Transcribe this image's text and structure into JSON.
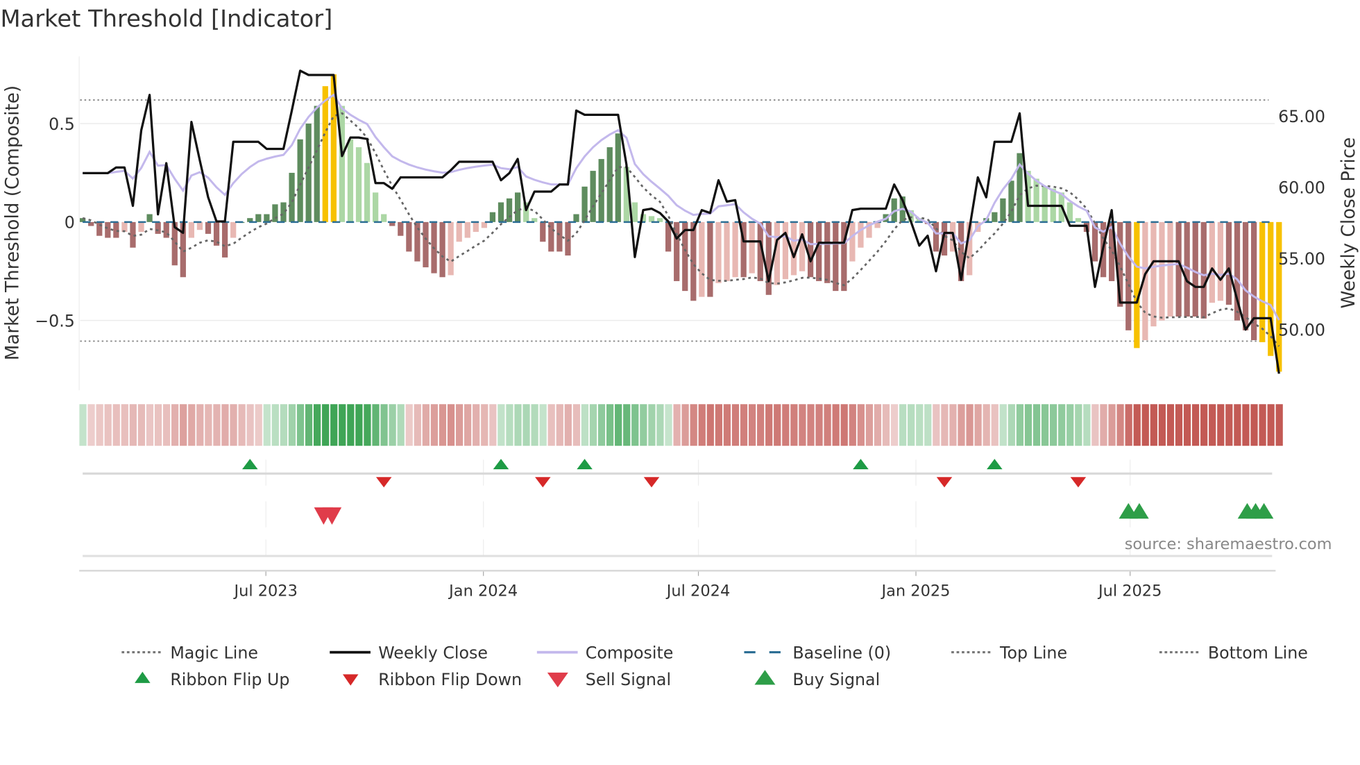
{
  "title": "Market Threshold [Indicator]",
  "source": "source: sharemaestro.com",
  "colors": {
    "dark_green": "#5e8c5e",
    "light_green": "#acd7a5",
    "dark_red": "#a86c6c",
    "light_red": "#e8b8b3",
    "yellow": "#f7c100",
    "close": "#111111",
    "composite": "#c3b8ec",
    "magic": "#666666",
    "baseline": "#2c6e94",
    "flip_up": "#1e9b45",
    "flip_down": "#d62828",
    "sell": "#e03c4a",
    "buy": "#2e9e48"
  },
  "chart_data": {
    "type": "bar",
    "title": "Market Threshold [Indicator]",
    "ylabel": "Market Threshold (Composite)",
    "y2label": "Weekly Close Price",
    "ylim": [
      -0.85,
      0.85
    ],
    "y2lim": [
      46.0,
      69.0
    ],
    "yticks": [
      {
        "v": 0.5,
        "label": "0.5"
      },
      {
        "v": 0,
        "label": "0"
      },
      {
        "v": -0.5,
        "label": "−0.5"
      }
    ],
    "y2ticks": [
      {
        "v": 65,
        "label": "65.00"
      },
      {
        "v": 60,
        "label": "60.00"
      },
      {
        "v": 55,
        "label": "55.00"
      },
      {
        "v": 50,
        "label": "50.00"
      }
    ],
    "top_line": 0.62,
    "bottom_line": -0.605,
    "baseline": 0,
    "x_unit": "week index",
    "xticks": [
      {
        "v": 21.9,
        "label": "Jul 2023"
      },
      {
        "v": 47.9,
        "label": "Jan 2024"
      },
      {
        "v": 73.6,
        "label": "Jul 2024"
      },
      {
        "v": 99.6,
        "label": "Jan 2025"
      },
      {
        "v": 125.2,
        "label": "Jul 2025"
      }
    ],
    "composite_bars": [
      0.02,
      -0.02,
      -0.07,
      -0.08,
      -0.08,
      -0.05,
      -0.13,
      -0.05,
      0.04,
      -0.06,
      -0.08,
      -0.22,
      -0.28,
      -0.08,
      -0.04,
      -0.06,
      -0.12,
      -0.18,
      -0.08,
      0.0,
      0.02,
      0.04,
      0.04,
      0.09,
      0.1,
      0.25,
      0.42,
      0.5,
      0.59,
      0.69,
      0.75,
      0.59,
      0.42,
      0.38,
      0.3,
      0.15,
      0.04,
      -0.02,
      -0.07,
      -0.15,
      -0.2,
      -0.23,
      -0.26,
      -0.28,
      -0.27,
      -0.1,
      -0.08,
      -0.05,
      -0.03,
      0.05,
      0.1,
      0.12,
      0.15,
      0.1,
      0.02,
      -0.1,
      -0.15,
      -0.15,
      -0.17,
      0.04,
      0.18,
      0.26,
      0.32,
      0.38,
      0.45,
      0.28,
      0.1,
      0.04,
      0.03,
      0.02,
      -0.15,
      -0.3,
      -0.35,
      -0.4,
      -0.38,
      -0.38,
      -0.31,
      -0.3,
      -0.28,
      -0.28,
      -0.26,
      -0.3,
      -0.37,
      -0.32,
      -0.29,
      -0.27,
      -0.25,
      -0.28,
      -0.3,
      -0.31,
      -0.35,
      -0.35,
      -0.2,
      -0.13,
      -0.08,
      -0.03,
      0.04,
      0.12,
      0.13,
      0.06,
      0.02,
      -0.01,
      -0.15,
      -0.17,
      -0.15,
      -0.3,
      -0.27,
      -0.05,
      0.02,
      0.05,
      0.12,
      0.21,
      0.35,
      0.26,
      0.22,
      0.18,
      0.17,
      0.15,
      0.1,
      0.02,
      -0.05,
      -0.2,
      -0.28,
      -0.3,
      -0.43,
      -0.55,
      -0.64,
      -0.6,
      -0.53,
      -0.5,
      -0.48,
      -0.48,
      -0.48,
      -0.48,
      -0.49,
      -0.41,
      -0.4,
      -0.42,
      -0.5,
      -0.55,
      -0.6,
      -0.61,
      -0.68,
      -0.76
    ],
    "weekly_close": [
      61.0,
      61.0,
      61.0,
      61.0,
      61.4,
      61.4,
      58.7,
      64.0,
      66.5,
      58.1,
      61.7,
      57.2,
      56.8,
      64.6,
      61.9,
      59.3,
      57.6,
      57.6,
      63.2,
      63.2,
      63.2,
      63.2,
      62.7,
      62.7,
      62.7,
      65.4,
      68.2,
      67.9,
      67.9,
      67.9,
      67.9,
      62.2,
      63.5,
      63.5,
      63.4,
      60.3,
      60.3,
      59.9,
      60.7,
      60.7,
      60.7,
      60.7,
      60.7,
      60.7,
      61.2,
      61.8,
      61.8,
      61.8,
      61.8,
      61.8,
      60.5,
      61.0,
      62.0,
      58.4,
      59.7,
      59.7,
      59.7,
      60.2,
      60.2,
      65.4,
      65.1,
      65.1,
      65.1,
      65.1,
      65.1,
      61.6,
      55.1,
      58.4,
      58.5,
      58.2,
      57.6,
      56.4,
      57.0,
      57.0,
      58.4,
      58.2,
      60.5,
      59.0,
      59.1,
      56.2,
      56.2,
      56.2,
      53.4,
      56.3,
      56.8,
      55.1,
      56.7,
      54.8,
      56.1,
      56.1,
      56.1,
      56.1,
      58.4,
      58.5,
      58.5,
      58.5,
      58.5,
      60.2,
      59.1,
      57.6,
      55.9,
      56.6,
      54.1,
      56.8,
      56.8,
      53.5,
      57.1,
      60.7,
      59.3,
      63.2,
      63.2,
      63.2,
      65.2,
      58.7,
      58.7,
      58.7,
      58.7,
      58.7,
      57.3,
      57.3,
      57.3,
      53.0,
      55.8,
      58.4,
      51.9,
      51.9,
      51.9,
      53.9,
      54.8,
      54.8,
      54.8,
      54.8,
      53.4,
      53.0,
      53.0,
      54.3,
      53.5,
      54.3,
      52.1,
      50.0,
      50.8,
      50.8,
      50.8,
      46.9
    ],
    "ribbon_flip_up": [
      20,
      50,
      60,
      93,
      109
    ],
    "ribbon_flip_down": [
      36,
      55,
      68,
      103,
      119
    ],
    "sell_signal": [
      28.8,
      29.8
    ],
    "buy_signal": [
      125,
      126.3,
      139.2,
      140.2,
      141.2
    ]
  },
  "legend": [
    {
      "label": "Magic Line",
      "style": "dotted-gray"
    },
    {
      "label": "Weekly Close",
      "style": "solid-black"
    },
    {
      "label": "Composite",
      "style": "solid-lavender"
    },
    {
      "label": "Baseline (0)",
      "style": "dashed-blue"
    },
    {
      "label": "Top Line",
      "style": "dotted-gray"
    },
    {
      "label": "Bottom Line",
      "style": "dotted-gray"
    },
    {
      "label": "Ribbon Flip Up",
      "style": "triangle-up-green"
    },
    {
      "label": "Ribbon Flip Down",
      "style": "triangle-down-red"
    },
    {
      "label": "Sell Signal",
      "style": "triangle-down-large-red"
    },
    {
      "label": "Buy Signal",
      "style": "triangle-up-large-green"
    }
  ]
}
